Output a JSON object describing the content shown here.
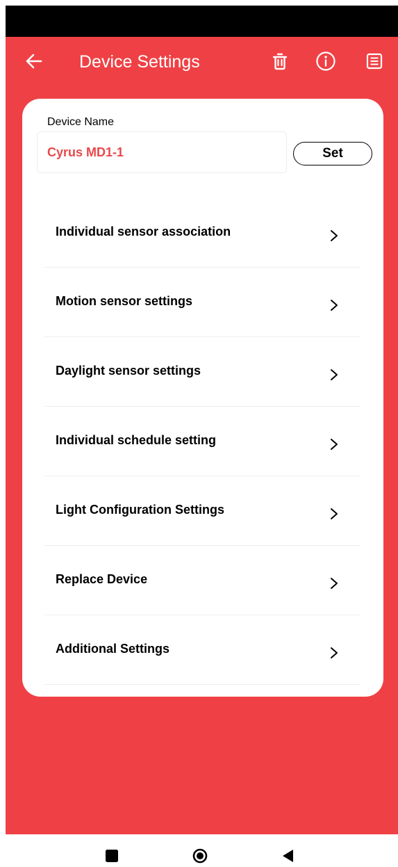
{
  "header": {
    "title": "Device Settings",
    "back_icon": "arrow-left-icon",
    "actions": [
      "trash-icon",
      "info-icon",
      "document-list-icon"
    ],
    "background_color": "#ef4145"
  },
  "device_name": {
    "label": "Device Name",
    "value": "Cyrus MD1-1",
    "value_color": "#e8484c",
    "set_label": "Set"
  },
  "menu": {
    "items": [
      {
        "label": "Individual sensor association"
      },
      {
        "label": "Motion sensor settings"
      },
      {
        "label": "Daylight sensor settings"
      },
      {
        "label": "Individual schedule setting"
      },
      {
        "label": "Light Configuration Settings"
      },
      {
        "label": "Replace Device"
      },
      {
        "label": "Additional Settings"
      }
    ]
  },
  "system_nav": {
    "buttons": [
      "recents-square-icon",
      "home-circle-icon",
      "back-triangle-icon"
    ]
  }
}
